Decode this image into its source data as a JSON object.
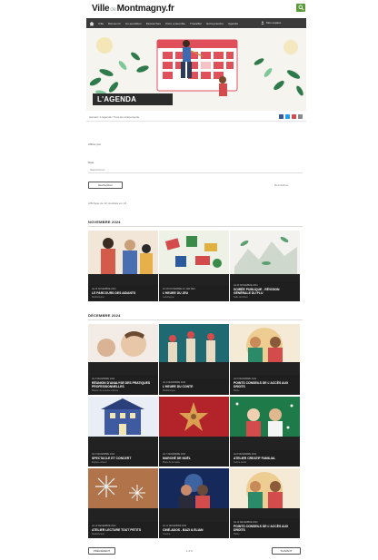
{
  "site": {
    "logo_left": "Ville",
    "logo_mid": "de",
    "logo_right": "Montmagny.fr"
  },
  "nav": {
    "items": [
      "Ville",
      "Découvrir",
      "Au quotidien",
      "Démarches",
      "Vivre ensemble",
      "Travailler",
      "Entreprendre",
      "Agenda"
    ],
    "user_label": "Mon espace"
  },
  "hero": {
    "title": "L'AGENDA",
    "banner_text": "Ville de Montmagny"
  },
  "breadcrumb": "Accueil / L'agenda / Tous les événements",
  "filters": {
    "heading": "Affiner par",
    "field_label": "Date",
    "field_placeholder": "Sélectionner",
    "apply_button": "Rechercher",
    "reset_link": "Réinitialiser",
    "results_text": "Affichage de 12 résultats sur 24"
  },
  "sections": [
    {
      "month": "NOVEMBRE 2024",
      "cards": [
        {
          "date": "LE 23 NOVEMBRE 2024",
          "title": "LE PARCOURS DES AIDANTS",
          "sub": "Médiathèque"
        },
        {
          "date": "DU 29 NOVEMBRE AU 1ER DÉC.",
          "title": "L'HEURE DU JEU",
          "sub": "Ludothèque"
        },
        {
          "date": "LE 30 NOVEMBRE 2024",
          "title": "SOIRÉE PUBLIQUE - RÉVISION GÉNÉRALE DU PLU",
          "sub": "Salle des fêtes"
        }
      ]
    },
    {
      "month": "DÉCEMBRE 2024",
      "cards": [
        {
          "date": "LE 3 DÉCEMBRE 2024",
          "title": "RÉUNION D'ANALYSE DES PRATIQUES PROFESSIONNELLES",
          "sub": "Maison de la petite enfance"
        },
        {
          "date": "LE 4 DÉCEMBRE 2024",
          "title": "L'HEURE DU CONTE",
          "sub": "Médiathèque"
        },
        {
          "date": "LE 5 DÉCEMBRE 2024",
          "title": "POINTS CONSEILS DE L'ACCÈS AUX DROITS",
          "sub": "Mairie"
        },
        {
          "date": "LE 6 DÉCEMBRE 2024",
          "title": "SPECTACLE ET CONCERT",
          "sub": "Espace culturel"
        },
        {
          "date": "LE 7 DÉCEMBRE 2024",
          "title": "MARCHÉ DE NOËL",
          "sub": "Place de la mairie"
        },
        {
          "date": "LE 8 DÉCEMBRE 2024",
          "title": "ATELIER CREATIF FAMILIAL",
          "sub": "Centre social"
        },
        {
          "date": "LE 10 DÉCEMBRE 2024",
          "title": "ATELIER LECTURE TOUT PETITS",
          "sub": "Médiathèque"
        },
        {
          "date": "LE 11 DÉCEMBRE 2024",
          "title": "CINÉ-ADOS - BAZI & ELIAN",
          "sub": "Cinéma"
        },
        {
          "date": "LE 12 DÉCEMBRE 2024",
          "title": "POINTS CONSEILS DE L'ACCÈS AUX DROITS",
          "sub": "Mairie"
        }
      ]
    }
  ],
  "pagination": {
    "prev": "PRÉCÉDENT",
    "pages": "1 2 3",
    "next": "SUIVANT"
  },
  "colors": {
    "nav_bg": "#3a3a3a",
    "accent_green": "#5a9a3a",
    "card_bg": "#1f1f1f",
    "hero_red": "#e0505a"
  }
}
